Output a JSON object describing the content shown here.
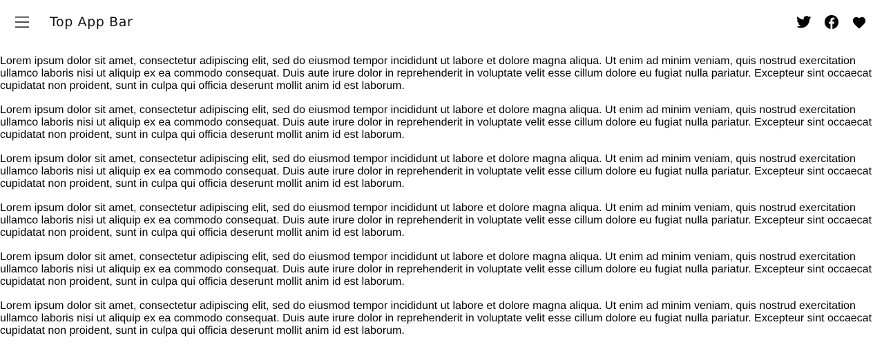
{
  "app_bar": {
    "title": "Top App Bar",
    "navigation_icon": "menu-icon",
    "actions": [
      {
        "icon": "twitter-icon"
      },
      {
        "icon": "facebook-icon"
      },
      {
        "icon": "heart-icon"
      }
    ]
  },
  "content": {
    "paragraphs": [
      {
        "line1": "Lorem ipsum dolor sit amet, consectetur adipiscing elit, sed do eiusmod tempor incididunt ut labore et dolore magna aliqua. Ut enim ad minim veniam, quis nostrud exercitation",
        "line2": "ullamco laboris nisi ut aliquip ex ea commodo consequat. Duis aute irure dolor in reprehenderit in voluptate velit esse cillum dolore eu fugiat nulla pariatur. Excepteur sint occaecat",
        "line3": "cupidatat non proident, sunt in culpa qui officia deserunt mollit anim id est laborum."
      },
      {
        "line1": "Lorem ipsum dolor sit amet, consectetur adipiscing elit, sed do eiusmod tempor incididunt ut labore et dolore magna aliqua. Ut enim ad minim veniam, quis nostrud exercitation",
        "line2": "ullamco laboris nisi ut aliquip ex ea commodo consequat. Duis aute irure dolor in reprehenderit in voluptate velit esse cillum dolore eu fugiat nulla pariatur. Excepteur sint occaecat",
        "line3": "cupidatat non proident, sunt in culpa qui officia deserunt mollit anim id est laborum."
      },
      {
        "line1": "Lorem ipsum dolor sit amet, consectetur adipiscing elit, sed do eiusmod tempor incididunt ut labore et dolore magna aliqua. Ut enim ad minim veniam, quis nostrud exercitation",
        "line2": "ullamco laboris nisi ut aliquip ex ea commodo consequat. Duis aute irure dolor in reprehenderit in voluptate velit esse cillum dolore eu fugiat nulla pariatur. Excepteur sint occaecat",
        "line3": "cupidatat non proident, sunt in culpa qui officia deserunt mollit anim id est laborum."
      },
      {
        "line1": "Lorem ipsum dolor sit amet, consectetur adipiscing elit, sed do eiusmod tempor incididunt ut labore et dolore magna aliqua. Ut enim ad minim veniam, quis nostrud exercitation",
        "line2": "ullamco laboris nisi ut aliquip ex ea commodo consequat. Duis aute irure dolor in reprehenderit in voluptate velit esse cillum dolore eu fugiat nulla pariatur. Excepteur sint occaecat",
        "line3": "cupidatat non proident, sunt in culpa qui officia deserunt mollit anim id est laborum."
      },
      {
        "line1": "Lorem ipsum dolor sit amet, consectetur adipiscing elit, sed do eiusmod tempor incididunt ut labore et dolore magna aliqua. Ut enim ad minim veniam, quis nostrud exercitation",
        "line2": "ullamco laboris nisi ut aliquip ex ea commodo consequat. Duis aute irure dolor in reprehenderit in voluptate velit esse cillum dolore eu fugiat nulla pariatur. Excepteur sint occaecat",
        "line3": "cupidatat non proident, sunt in culpa qui officia deserunt mollit anim id est laborum."
      },
      {
        "line1": "Lorem ipsum dolor sit amet, consectetur adipiscing elit, sed do eiusmod tempor incididunt ut labore et dolore magna aliqua. Ut enim ad minim veniam, quis nostrud exercitation",
        "line2": "ullamco laboris nisi ut aliquip ex ea commodo consequat. Duis aute irure dolor in reprehenderit in voluptate velit esse cillum dolore eu fugiat nulla pariatur. Excepteur sint occaecat",
        "line3": "cupidatat non proident, sunt in culpa qui officia deserunt mollit anim id est laborum."
      }
    ]
  }
}
